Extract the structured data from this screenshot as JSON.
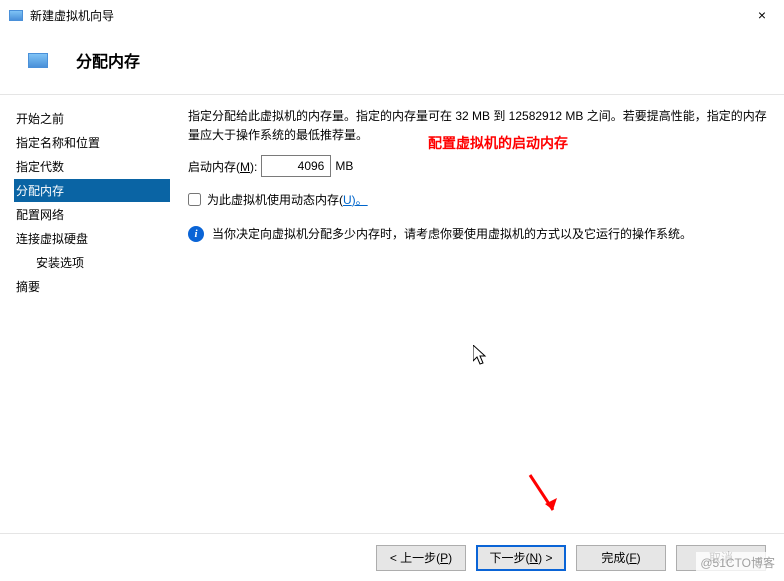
{
  "titlebar": {
    "title": "新建虚拟机向导",
    "close_label": "×"
  },
  "header": {
    "title": "分配内存"
  },
  "sidebar": {
    "items": [
      {
        "label": "开始之前"
      },
      {
        "label": "指定名称和位置"
      },
      {
        "label": "指定代数"
      },
      {
        "label": "分配内存",
        "selected": true
      },
      {
        "label": "配置网络"
      },
      {
        "label": "连接虚拟硬盘"
      },
      {
        "label": "安装选项",
        "child": true
      },
      {
        "label": "摘要"
      }
    ]
  },
  "content": {
    "description": "指定分配给此虚拟机的内存量。指定的内存量可在 32 MB 到 12582912 MB 之间。若要提高性能，指定的内存量应大于操作系统的最低推荐量。",
    "mem_label_pre": "启动内存(",
    "mem_mnemonic": "M",
    "mem_label_post": "):",
    "mem_value": "4096",
    "mem_unit": "MB",
    "dyn_label_pre": "为此虚拟机使用动态内存(",
    "dyn_mnemonic": "U",
    "dyn_label_post": ")。",
    "info_text": "当你决定向虚拟机分配多少内存时，请考虑你要使用虚拟机的方式以及它运行的操作系统。"
  },
  "annotation": {
    "text": "配置虚拟机的启动内存"
  },
  "footer": {
    "back_pre": "< 上一步(",
    "back_m": "P",
    "back_post": ")",
    "next_pre": "下一步(",
    "next_m": "N",
    "next_post": ") >",
    "finish_pre": "完成(",
    "finish_m": "F",
    "finish_post": ")",
    "cancel": "取消"
  },
  "watermark": "@51CTO博客"
}
